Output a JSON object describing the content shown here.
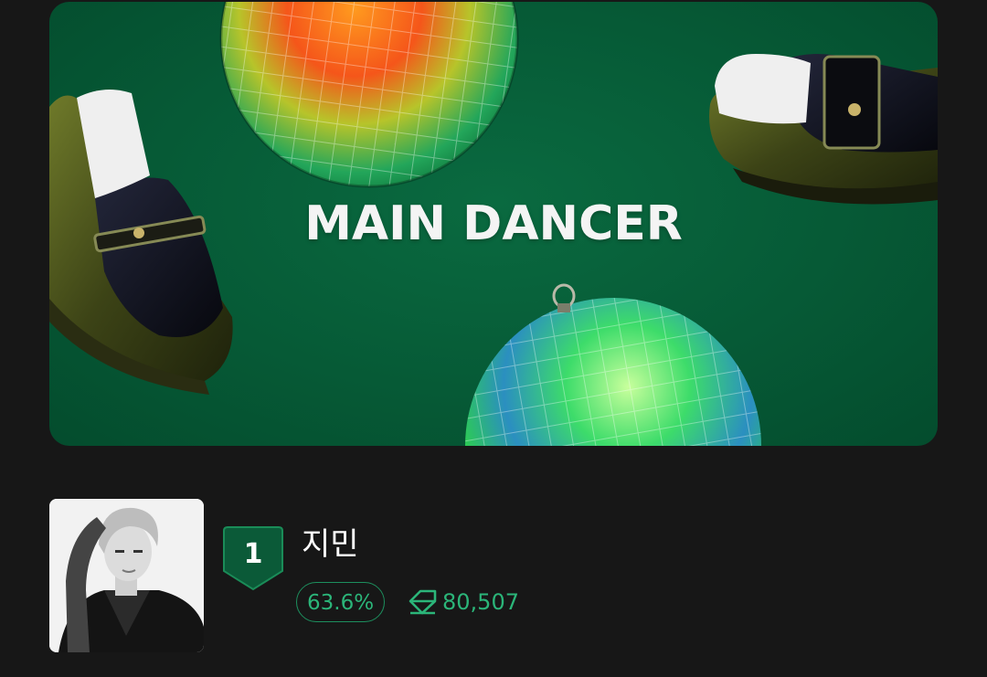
{
  "banner": {
    "title": "MAIN DANCER",
    "colors": {
      "background": "#065a36",
      "title": "#f4f4f4"
    }
  },
  "ranking": {
    "rank": "1",
    "name": "지민",
    "percent": "63.6%",
    "votes": "80,507",
    "vote_icon": "diamond-icon",
    "avatar": "member-photo",
    "colors": {
      "accent": "#2bb579",
      "badge": "#0b5a38",
      "page_background": "#171717"
    }
  }
}
